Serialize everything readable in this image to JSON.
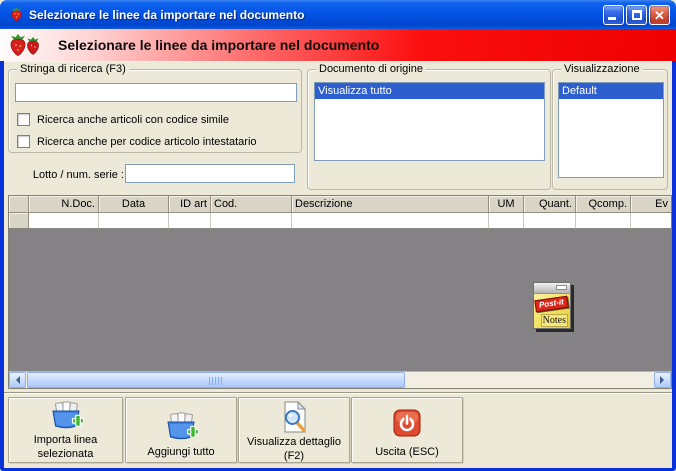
{
  "window": {
    "title": "Selezionare le linee da importare nel documento"
  },
  "header": {
    "title": "Selezionare le linee da importare nel documento"
  },
  "search_group": {
    "title": "Stringa di ricerca (F3)",
    "input_value": "",
    "checkbox1_label": "Ricerca anche articoli con codice simile",
    "checkbox2_label": "Ricerca anche per codice articolo intestatario",
    "lotto_label": "Lotto / num. serie :",
    "lotto_value": ""
  },
  "origin_group": {
    "title": "Documento di origine",
    "items": [
      "Visualizza tutto"
    ],
    "selected": "Visualizza tutto"
  },
  "view_group": {
    "title": "Visualizzazione",
    "items": [
      "Default"
    ],
    "selected": "Default"
  },
  "table": {
    "columns": [
      "",
      "N.Doc.",
      "Data",
      "ID art",
      "Cod.",
      "Descrizione",
      "UM",
      "Quant.",
      "Qcomp.",
      "Ev"
    ],
    "rows": [
      [
        "",
        "",
        "",
        "",
        "",
        "",
        "",
        "",
        "",
        ""
      ]
    ]
  },
  "postit_icon": {
    "line1": "Post-it",
    "line2": "Notes"
  },
  "toolbar": {
    "import_line1": "Importa linea",
    "import_line2": "selezionata",
    "add_all_label": "Aggiungi tutto",
    "detail_line1": "Visualizza dettaglio",
    "detail_line2": "(F2)",
    "exit_label": "Uscita (ESC)"
  },
  "colors": {
    "titlebar_blue": "#0454e6",
    "window_border_blue": "#0831d9",
    "band_red": "#ee0000",
    "client_beige": "#ece9d8",
    "selection_blue": "#2e5fce",
    "grid_filler_gray": "#848284",
    "header_cell": "#d8d4c6",
    "postit_yellow": "#f2df5e",
    "postit_banner_red": "#dd2518"
  }
}
